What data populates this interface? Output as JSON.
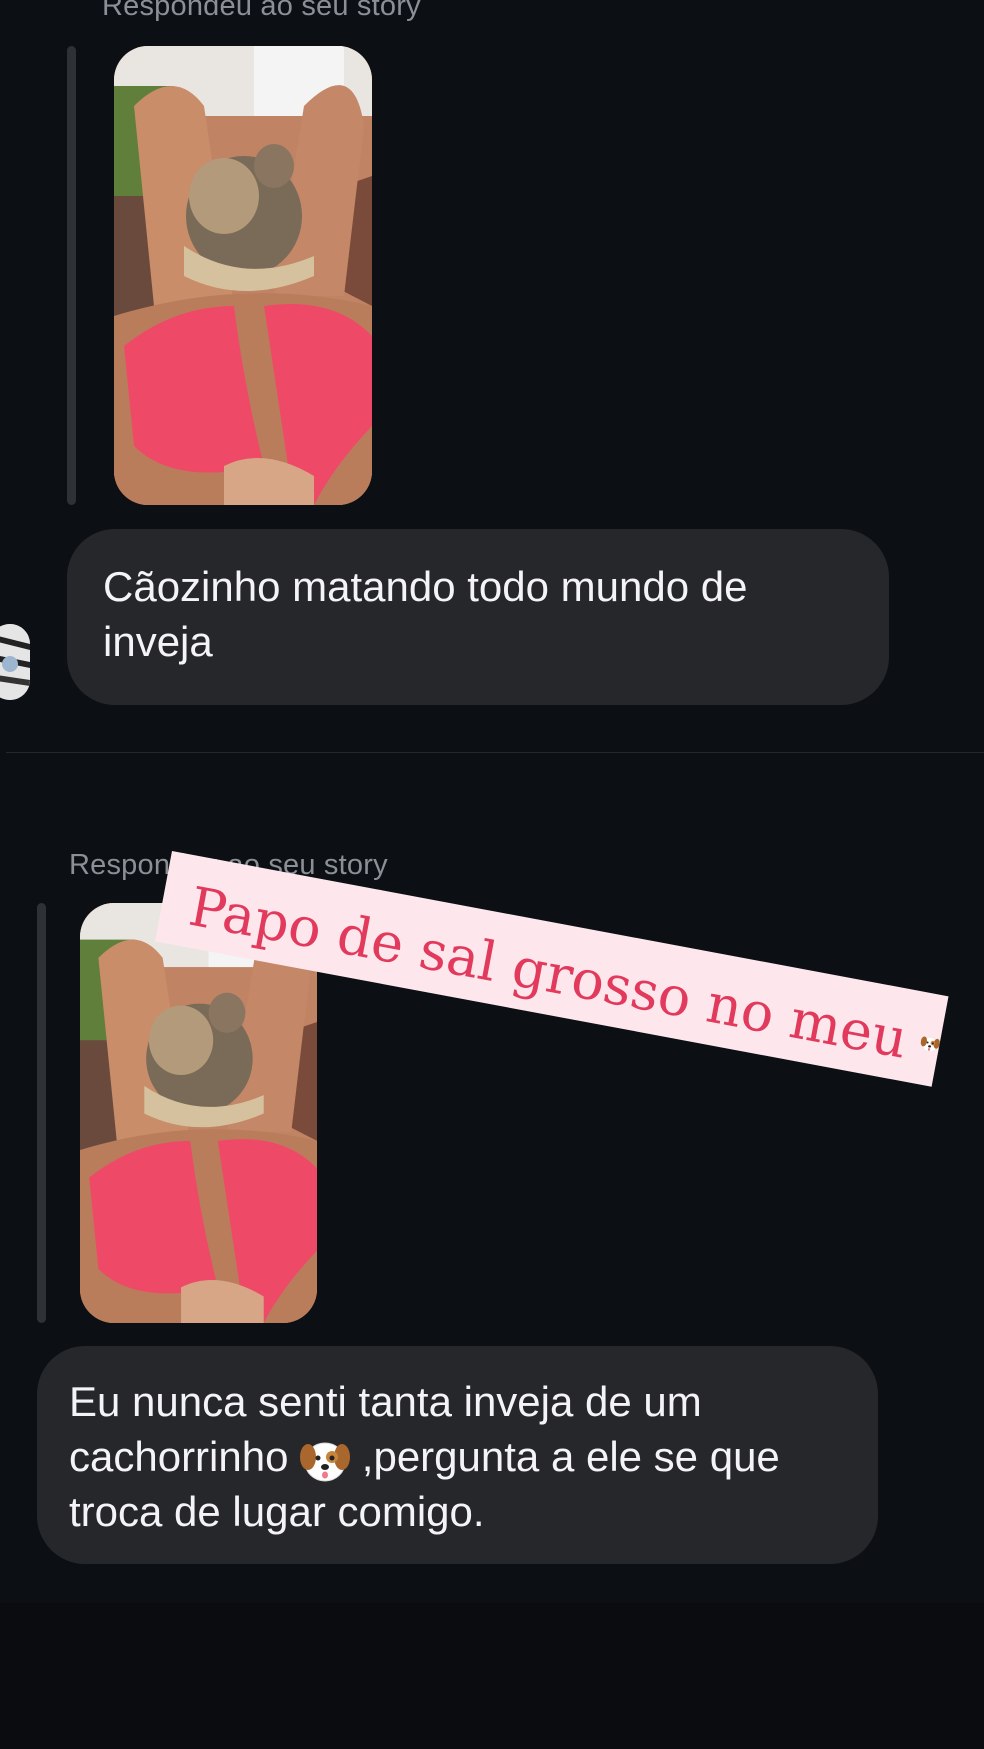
{
  "thread": {
    "messages": [
      {
        "reply_label": "Respondeu ao seu story",
        "text": "Cãozinho matando todo mundo de\ninveja"
      },
      {
        "reply_label": "Respondeu ao seu story",
        "text_before_emoji": "Eu nunca senti tanta inveja de um\ncachorrinho ",
        "emoji": "dog-face",
        "text_after_emoji": " ,pergunta  a ele se que\ntroca de lugar comigo."
      }
    ]
  },
  "sticker": {
    "text": "Papo de sal grosso no meu",
    "emoji": "dog-face",
    "background": "#fde6ec",
    "color": "#e23a5c"
  },
  "colors": {
    "background": "#0c0f13",
    "bubble": "#25272b",
    "label": "#8b8f96"
  }
}
